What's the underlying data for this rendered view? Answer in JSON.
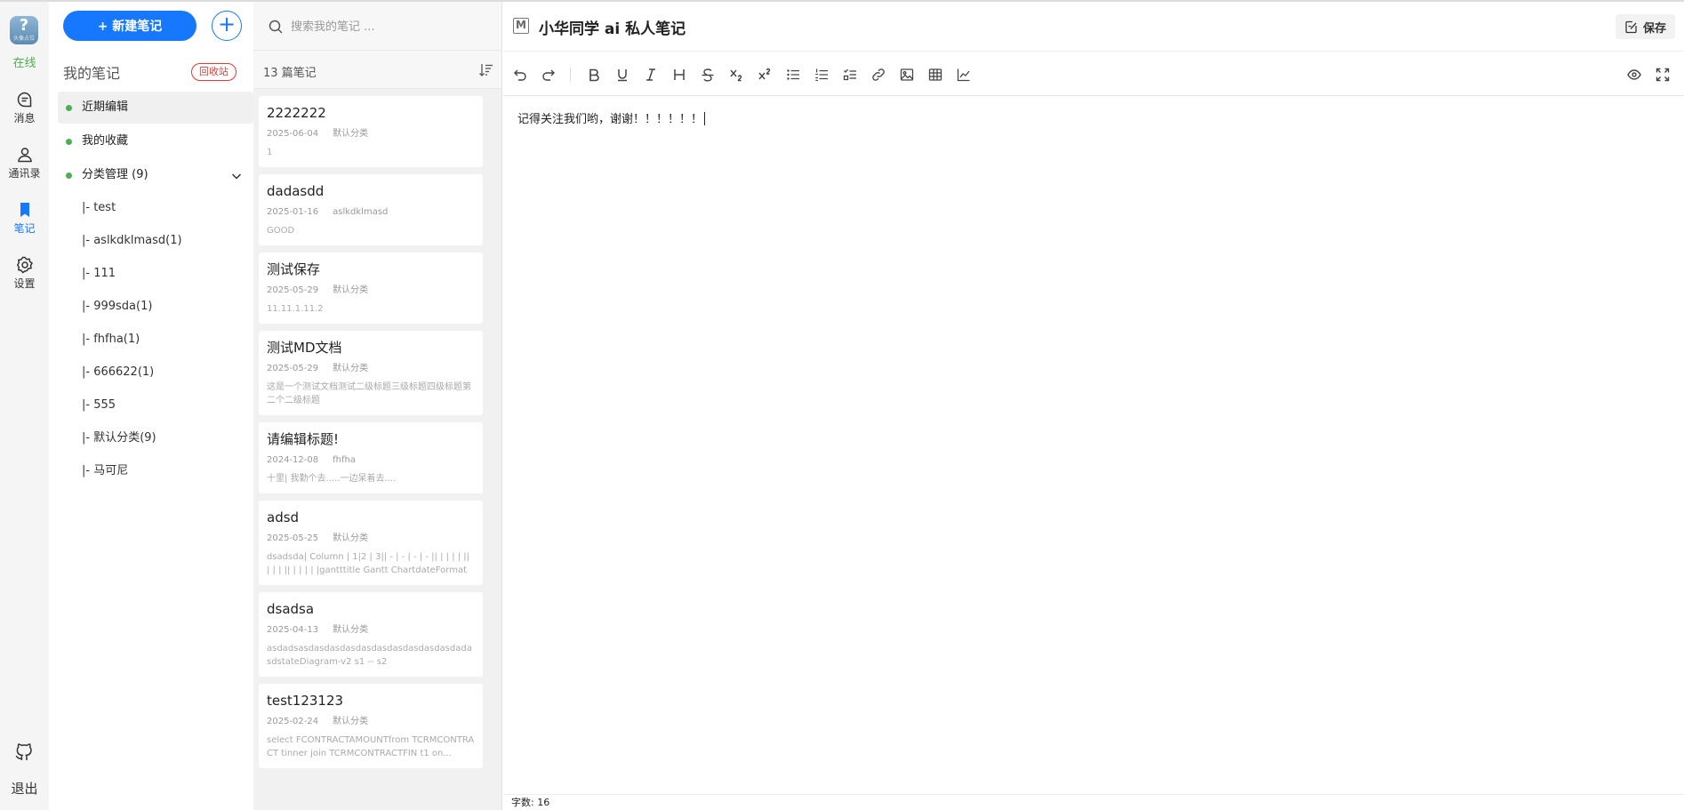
{
  "rail": {
    "avatar_glyph": "?",
    "avatar_sub": "头像占位",
    "status": "在线",
    "nav": [
      {
        "label": "消息",
        "icon": "message-icon"
      },
      {
        "label": "通讯录",
        "icon": "contacts-icon"
      },
      {
        "label": "笔记",
        "icon": "bookmark-icon"
      },
      {
        "label": "设置",
        "icon": "gear-icon"
      }
    ],
    "logout": "退出"
  },
  "sidebar": {
    "new_note": "+ 新建笔记",
    "title": "我的笔记",
    "recycle": "回收站",
    "menu": [
      {
        "label": "近期编辑"
      },
      {
        "label": "我的收藏"
      },
      {
        "label": "分类管理 (9)"
      }
    ],
    "categories": [
      "|- test",
      "|- aslkdklmasd(1)",
      "|- 111",
      "|- 999sda(1)",
      "|- fhfha(1)",
      "|- 666622(1)",
      "|- 555",
      "|- 默认分类(9)",
      "|- 马可尼"
    ]
  },
  "list": {
    "search_placeholder": "搜索我的笔记 ...",
    "count": "13 篇笔记",
    "notes": [
      {
        "title": "2222222",
        "date": "2025-06-04",
        "category": "默认分类",
        "summary": "1"
      },
      {
        "title": "dadasdd",
        "date": "2025-01-16",
        "category": "aslkdklmasd",
        "summary": "GOOD"
      },
      {
        "title": "测试保存",
        "date": "2025-05-29",
        "category": "默认分类",
        "summary": "11.11.1.11.2"
      },
      {
        "title": "测试MD文档",
        "date": "2025-05-29",
        "category": "默认分类",
        "summary": "这是一个测试文档测试二级标题三级标题四级标题第二个二级标题"
      },
      {
        "title": "请编辑标题!",
        "date": "2024-12-08",
        "category": "fhfha",
        "summary": "十里| 我勤个去.....一边呆着去...."
      },
      {
        "title": "adsd",
        "date": "2025-05-25",
        "category": "默认分类",
        "summary": "dsadsda| Column | 1|2 | 3|| - | - | - | - || | | | | || | | | || | | | | |gantttitle Gantt ChartdateFormat YYYY-MM-..."
      },
      {
        "title": "dsadsa",
        "date": "2025-04-13",
        "category": "默认分类",
        "summary": "asdadsasdasdasdasdasdasdasdasdasdasdadasdstateDiagram-v2 s1 -- s2"
      },
      {
        "title": "test123123",
        "date": "2025-02-24",
        "category": "默认分类",
        "summary": "select FCONTRACTAMOUNTfrom TCRMCONTRACT tinner join TCRMCONTRACTFIN t1 on..."
      }
    ]
  },
  "editor": {
    "title": "小华同学 ai 私人笔记",
    "save": "保存",
    "content": "记得关注我们哟，谢谢！！！！！！",
    "word_count": "字数: 16"
  }
}
